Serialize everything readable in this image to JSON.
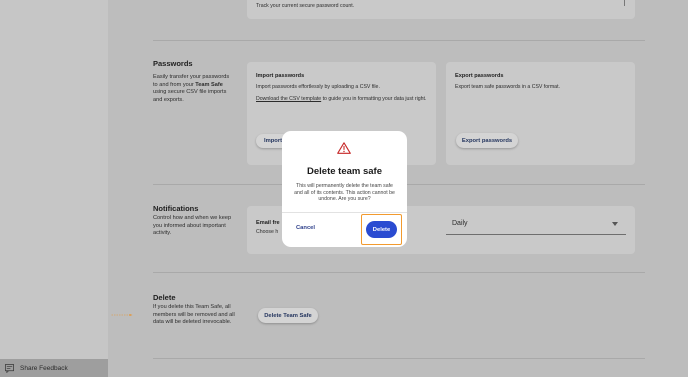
{
  "sidebar": {
    "feedback_label": "Share Feedback"
  },
  "top_card": {
    "text": "Track your current secure password count."
  },
  "passwords": {
    "title": "Passwords",
    "desc_before": "Easily transfer your passwords to and from your ",
    "desc_bold": "Team Safe",
    "desc_after": " using secure CSV file imports and exports.",
    "import": {
      "title": "Import passwords",
      "text": "Import passwords effortlessly by uploading a CSV file.",
      "link": "Download the CSV template",
      "link_after": " to guide you in formatting your data just right.",
      "button": "Import"
    },
    "export": {
      "title": "Export passwords",
      "text": "Export team safe passwords in a CSV format.",
      "button": "Export passwords"
    }
  },
  "notifications": {
    "title": "Notifications",
    "desc": "Control how and when we keep you informed about important activity.",
    "label": "Email fre",
    "sub": "Choose h",
    "select_value": "Daily"
  },
  "delete_section": {
    "title": "Delete",
    "desc": "If you delete this Team Safe, all members will be removed and all data will be deleted irrevocable.",
    "button": "Delete Team Safe"
  },
  "modal": {
    "title": "Delete team safe",
    "message": "This will permanently delete the team safe and all of its contents. This action cannot be undone. Are you sure?",
    "cancel": "Cancel",
    "confirm": "Delete",
    "icon": "warning-icon"
  },
  "colors": {
    "accent": "#2a4bd1",
    "highlight": "#f29a2e",
    "warning": "#c62828"
  }
}
